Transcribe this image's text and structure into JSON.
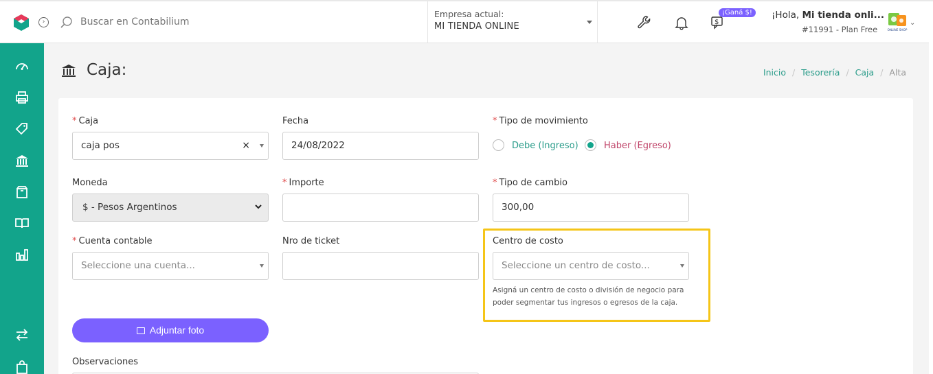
{
  "topbar": {
    "search_placeholder": "Buscar en Contabilium",
    "empresa_label": "Empresa actual:",
    "empresa_value": "MI TIENDA ONLINE",
    "gana_badge": "¡Ganá $!",
    "greeting_prefix": "¡Hola, ",
    "greeting_name": "Mi tienda onli...",
    "plan": "#11991 - Plan Free",
    "avatar_text": "ONLINE SHOP"
  },
  "page": {
    "title": "Caja:",
    "breadcrumb": [
      "Inicio",
      "Tesorería",
      "Caja",
      "Alta"
    ]
  },
  "form": {
    "caja_label": "Caja",
    "caja_value": "caja pos",
    "fecha_label": "Fecha",
    "fecha_value": "24/08/2022",
    "tipo_label": "Tipo de movimiento",
    "tipo_opcion_debe": "Debe (Ingreso)",
    "tipo_opcion_haber": "Haber (Egreso)",
    "tipo_selected": "Haber (Egreso)",
    "moneda_label": "Moneda",
    "moneda_value": "$ - Pesos Argentinos",
    "importe_label": "Importe",
    "importe_value": "",
    "tipo_cambio_label": "Tipo de cambio",
    "tipo_cambio_value": "300,00",
    "cuenta_label": "Cuenta contable",
    "cuenta_placeholder": "Seleccione una cuenta...",
    "ticket_label": "Nro de ticket",
    "ticket_value": "",
    "centro_label": "Centro de costo",
    "centro_placeholder": "Seleccione un centro de costo...",
    "centro_help": "Asigná un centro de costo o división de negocio para poder segmentar tus ingresos o egresos de la caja.",
    "adjuntar_label": "Adjuntar foto",
    "observaciones_label": "Observaciones"
  },
  "colors": {
    "brand_green": "#12a48b",
    "accent_purple": "#7b61ff",
    "highlight": "#f5c518",
    "haber_red": "#c0456a"
  },
  "icons": {
    "sidebar": [
      "dashboard-icon",
      "printer-icon",
      "tag-icon",
      "bank-icon",
      "box-icon",
      "book-icon",
      "bar-chart-icon",
      "transfer-icon",
      "bag-icon"
    ],
    "topbar": [
      "wrench-icon",
      "bell-icon",
      "money-chat-icon"
    ]
  }
}
